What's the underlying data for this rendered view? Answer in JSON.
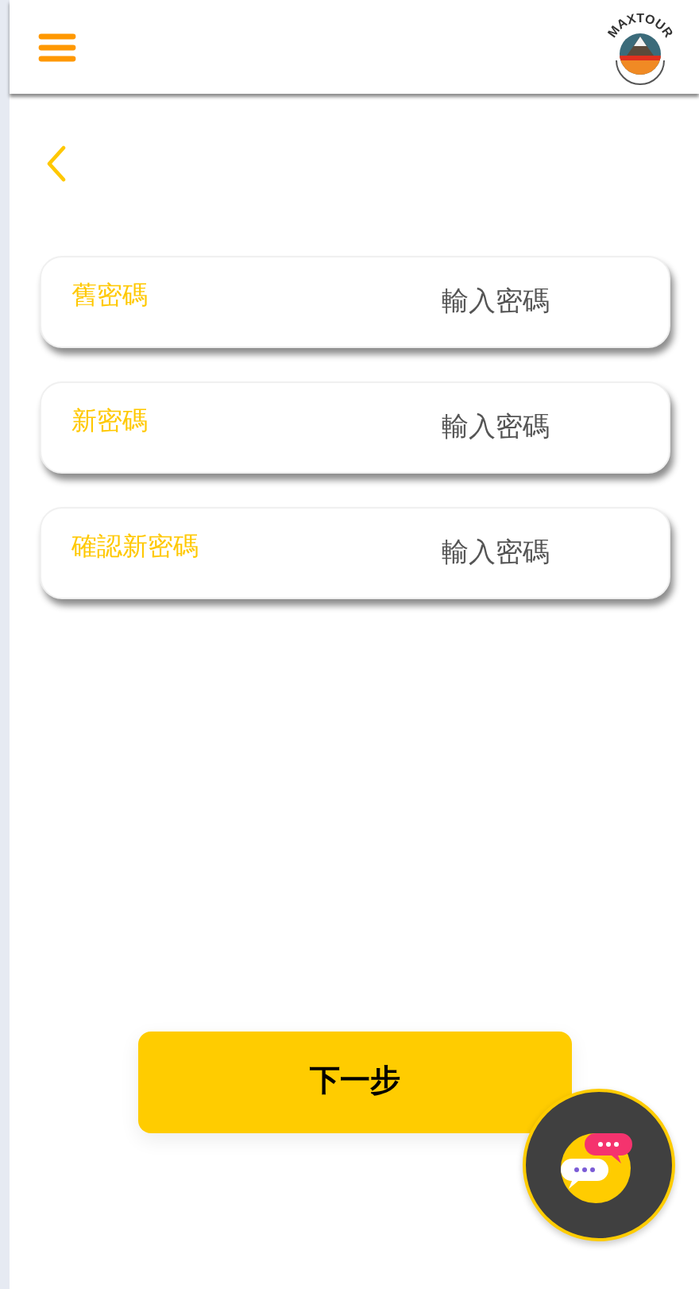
{
  "header": {
    "logo_text": "MAXTOUR"
  },
  "fields": [
    {
      "label": "舊密碼",
      "placeholder": "輸入密碼"
    },
    {
      "label": "新密碼",
      "placeholder": "輸入密碼"
    },
    {
      "label": "確認新密碼",
      "placeholder": "輸入密碼"
    }
  ],
  "next_button": "下一步"
}
